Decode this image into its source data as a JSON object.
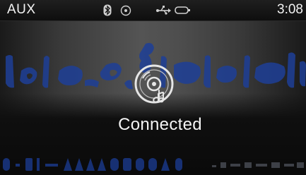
{
  "status_bar": {
    "source": "AUX",
    "time": "3:08",
    "icons": [
      "bluetooth-icon",
      "disc-icon",
      "usb-icon",
      "phone-icon"
    ]
  },
  "main": {
    "status_text": "Connected",
    "icon": "cd-music-icon"
  },
  "colors": {
    "watermark_blue": "#1e3f97",
    "text": "#f4f4f4"
  }
}
